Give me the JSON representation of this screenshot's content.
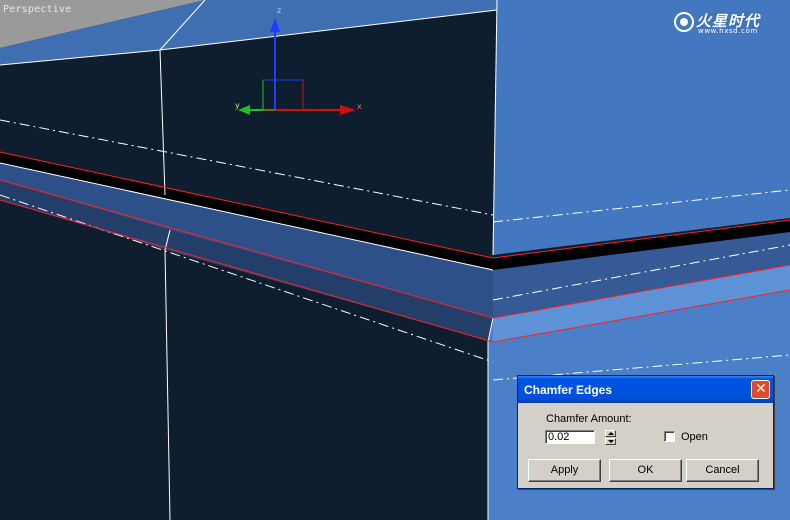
{
  "viewport": {
    "label": "Perspective",
    "gizmo_axes": {
      "x": "x",
      "y": "y",
      "z": "z"
    }
  },
  "watermark": {
    "name": "火星时代",
    "url": "www.hxsd.com"
  },
  "dialog": {
    "title": "Chamfer Edges",
    "amount_label": "Chamfer Amount:",
    "amount_value": "0.02",
    "open_label": "Open",
    "open_checked": false,
    "buttons": {
      "apply": "Apply",
      "ok": "OK",
      "cancel": "Cancel"
    }
  },
  "colors": {
    "dark_face": "#0f1e2e",
    "blue_face": "#3f73b8",
    "selected_edge": "#ff2020",
    "dialog_title": "#0054e3"
  }
}
